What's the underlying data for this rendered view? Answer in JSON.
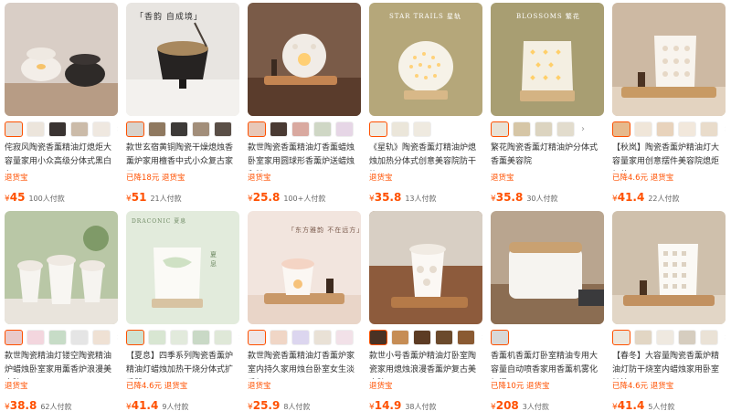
{
  "products": [
    {
      "title": "侘寂风陶瓷香薰精油灯熄炬大容量家用小众高级分体式黑白色",
      "tag": "退货宝",
      "currency": "¥",
      "price": "45",
      "sold": "100人付款",
      "thumb_colors": [
        "#e7ded6",
        "#ece5dc",
        "#3a3432",
        "#cbbba9",
        "#efe8e0"
      ],
      "photo_theme": "#d9cec6"
    },
    {
      "title": "款世玄宿黄铜陶瓷干燥熄烛香薰炉家用檀香中式小众复古家用",
      "tag": "已降18元 退货宝",
      "currency": "¥",
      "price": "51",
      "sold": "21人付款",
      "thumb_colors": [
        "#d8d2cb",
        "#8f7960",
        "#3d3a38",
        "#a28e7a",
        "#5a4f47"
      ],
      "photo_theme": "#e8e5e1",
      "photo_caption": "「香韵 自成境」"
    },
    {
      "title": "款世陶瓷香薰精油灯香薰蜡烛卧室家用圆球形香薰炉送蜡烛和精",
      "tag": "退货宝",
      "currency": "¥",
      "price": "25.8",
      "sold": "100+人付款",
      "thumb_colors": [
        "#e8c8b8",
        "#4a3a33",
        "#d9a9a0",
        "#cfd7c5",
        "#e6d6e6"
      ],
      "photo_theme": "#7a5b48"
    },
    {
      "title": "《星轨》陶瓷香薰灯精油炉熄烛加热分体式创意美容院防干烧",
      "tag": "退货宝",
      "currency": "¥",
      "price": "35.8",
      "sold": "13人付款",
      "thumb_colors": [
        "#f0ece2",
        "#ebe6da",
        "#efeae0"
      ],
      "photo_theme": "#b5a77a",
      "photo_caption": "STAR TRAILS 星轨"
    },
    {
      "title": "繁花陶瓷香薰灯精油炉分体式香薰美容院",
      "tag": "退货宝",
      "currency": "¥",
      "price": "35.8",
      "sold": "30人付款",
      "thumb_colors": [
        "#e8e2d6",
        "#d6c6a6",
        "#dcd4c0",
        "#e2dccd"
      ],
      "photo_theme": "#a89e72",
      "photo_caption": "BLOSSOMS 繁花"
    },
    {
      "title": "【秋岚】陶瓷香薰炉精油灯大容量家用创意摆件美容院熄炬加热",
      "tag": "已降4.6元 退货宝",
      "currency": "¥",
      "price": "41.4",
      "sold": "22人付款",
      "thumb_colors": [
        "#e6b98c",
        "#f0e6d9",
        "#e8d3bc",
        "#f2e8dc",
        "#e9dccb"
      ],
      "photo_theme": "#cdb9a3"
    },
    {
      "title": "款世陶瓷精油灯镂空陶瓷精油炉蜡烛卧室家用薰香炉浪漫美容院",
      "tag": "退货宝",
      "currency": "¥",
      "price": "38.8",
      "sold": "62人付款",
      "thumb_colors": [
        "#e9c9c9",
        "#f3d6de",
        "#c7dcc7",
        "#e5e5e5",
        "#efe1d4"
      ],
      "photo_theme": "#b9c7a6"
    },
    {
      "title": "【夏息】四季系列陶瓷香薰炉精油灯蜡烛加热干烧分体式扩香器",
      "tag": "已降4.6元 退货宝",
      "currency": "¥",
      "price": "41.4",
      "sold": "9人付款",
      "thumb_colors": [
        "#cfe1cf",
        "#d8e6d2",
        "#e2eadc",
        "#c9d9c6",
        "#dfe8d8"
      ],
      "photo_theme": "#e2ebdc",
      "photo_caption": "DRACONIC 夏息"
    },
    {
      "title": "款世陶瓷香薰精油灯香薰炉家室内持久家用烛台卧室女生淡香加",
      "tag": "退货宝",
      "currency": "¥",
      "price": "25.9",
      "sold": "8人付款",
      "thumb_colors": [
        "#efe6e6",
        "#f0d6c6",
        "#dcd6ef",
        "#e9e1d6",
        "#f2e1e8"
      ],
      "photo_theme": "#f2e5de",
      "photo_caption": "「东方雅韵 不在远方」"
    },
    {
      "title": "款世小号香薰炉精油灯卧室陶瓷家用熄烛浪漫香薰炉复古美容院",
      "tag": "退货宝",
      "currency": "¥",
      "price": "14.9",
      "sold": "38人付款",
      "thumb_colors": [
        "#4a3224",
        "#c68d55",
        "#5d3c24",
        "#6b4a2c",
        "#8a5a32"
      ],
      "photo_theme": "#8d5b3c"
    },
    {
      "title": "香薰机香薰灯卧室精油专用大容量自动喷香家用香薰机雾化加湿",
      "tag": "已降10元 退货宝",
      "currency": "¥",
      "price": "208",
      "sold": "3人付款",
      "thumb_colors": [
        "#d8d8d8"
      ],
      "photo_theme": "#b9a58f"
    },
    {
      "title": "【春冬】大容量陶瓷香薰炉精油灯防干烧室内蜡烛家用卧室精油",
      "tag": "已降4.6元 退货宝",
      "currency": "¥",
      "price": "41.4",
      "sold": "5人付款",
      "thumb_colors": [
        "#ece6dc",
        "#e2d6c4",
        "#efe9e0",
        "#d6cdbf",
        "#eae2d6"
      ],
      "photo_theme": "#cfc0ac"
    }
  ],
  "icons": {
    "thumb_next": "chevron-right-icon"
  }
}
